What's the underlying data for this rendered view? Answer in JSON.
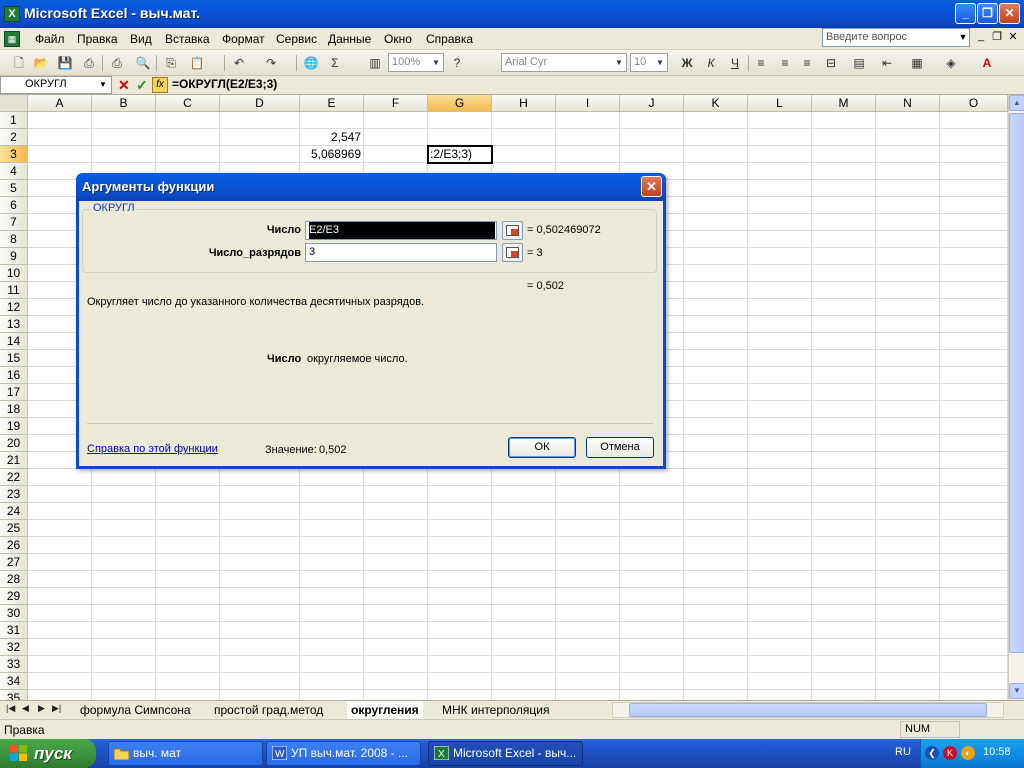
{
  "window": {
    "title": "Microsoft Excel - выч.мат."
  },
  "menu": {
    "items": [
      "Файл",
      "Правка",
      "Вид",
      "Вставка",
      "Формат",
      "Сервис",
      "Данные",
      "Окно",
      "Справка"
    ],
    "question_placeholder": "Введите вопрос"
  },
  "toolbar": {
    "zoom": "100%",
    "font": "Arial Cyr",
    "font_size": "10"
  },
  "formula_bar": {
    "name_box": "ОКРУГЛ",
    "formula": "=ОКРУГЛ(E2/E3;3)",
    "fx": "fx"
  },
  "grid": {
    "columns": [
      "A",
      "B",
      "C",
      "D",
      "E",
      "F",
      "G",
      "H",
      "I",
      "J",
      "K",
      "L",
      "M",
      "N",
      "O"
    ],
    "rows": [
      "1",
      "2",
      "3",
      "4",
      "5",
      "6",
      "7",
      "8",
      "9",
      "10",
      "11",
      "12",
      "13",
      "14",
      "15",
      "16",
      "17",
      "18",
      "19",
      "20",
      "21",
      "22",
      "23",
      "24",
      "25",
      "26",
      "27",
      "28",
      "29",
      "30",
      "31",
      "32",
      "33",
      "34",
      "35"
    ],
    "selected_column": "G",
    "selected_row": "3",
    "cells": {
      "E2": "2,547",
      "E3": "5,068969",
      "G3": ":2/E3;3)"
    }
  },
  "dialog": {
    "title": "Аргументы функции",
    "function_name": "ОКРУГЛ",
    "args": [
      {
        "label": "Число",
        "value": "E2/E3",
        "result": "= 0,502469072"
      },
      {
        "label": "Число_разрядов",
        "value": "3",
        "result": "= 3"
      }
    ],
    "formula_result": "= 0,502",
    "description": "Округляет число до указанного количества десятичных разрядов.",
    "arg_help_name": "Число",
    "arg_help_text": "округляемое число.",
    "help_link": "Справка по этой функции",
    "value_label": "Значение:",
    "value": "0,502",
    "ok": "ОК",
    "cancel": "Отмена"
  },
  "sheet_tabs": {
    "tabs": [
      "формула Симпсона",
      "простой град.метод",
      "округления",
      "МНК интерполяция"
    ],
    "active": "округления"
  },
  "status": {
    "text": "Правка",
    "num": "NUM"
  },
  "taskbar": {
    "start": "пуск",
    "items": [
      "выч. мат",
      "УП выч.мат. 2008 - ...",
      "Microsoft Excel - выч..."
    ],
    "lang": "RU",
    "clock": "10:58"
  },
  "colors": {
    "title_blue": "#0a4bd6",
    "selection_orange": "#f5b94d",
    "taskbar_blue": "#245edb",
    "start_green": "#3a8f3a"
  }
}
